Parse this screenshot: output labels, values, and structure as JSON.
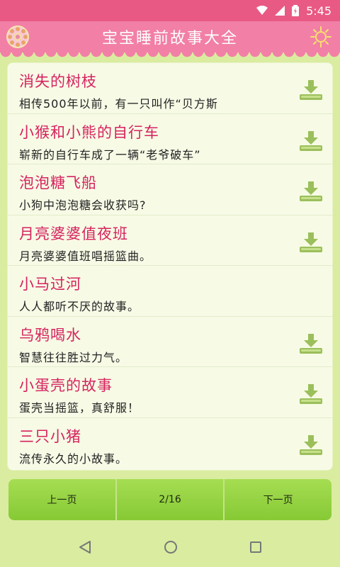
{
  "status_bar": {
    "time": "5:45"
  },
  "header": {
    "title": "宝宝睡前故事大全"
  },
  "stories": [
    {
      "title": "消失的树枝",
      "desc": "相传500年以前，有一只叫作“贝方斯",
      "downloadable": true
    },
    {
      "title": "小猴和小熊的自行车",
      "desc": "崭新的自行车成了一辆“老爷破车”",
      "downloadable": true
    },
    {
      "title": "泡泡糖飞船",
      "desc": "小狗中泡泡糖会收获吗?",
      "downloadable": true
    },
    {
      "title": "月亮婆婆值夜班",
      "desc": "月亮婆婆值班唱摇篮曲。",
      "downloadable": true
    },
    {
      "title": "小马过河",
      "desc": "人人都听不厌的故事。",
      "downloadable": false
    },
    {
      "title": "乌鸦喝水",
      "desc": "智慧往往胜过力气。",
      "downloadable": true
    },
    {
      "title": "小蛋壳的故事",
      "desc": "蛋壳当摇篮，真舒服！",
      "downloadable": true
    },
    {
      "title": "三只小猪",
      "desc": "流传永久的小故事。",
      "downloadable": true
    }
  ],
  "pager": {
    "prev_label": "上一页",
    "page_indicator": "2/16",
    "next_label": "下一页"
  },
  "colors": {
    "header_bg": "#f27fa6",
    "title_text": "#d6235f",
    "panel_bg": "#f7fbe6",
    "page_bg": "#d9ec9f",
    "button_green": "#95d343"
  }
}
